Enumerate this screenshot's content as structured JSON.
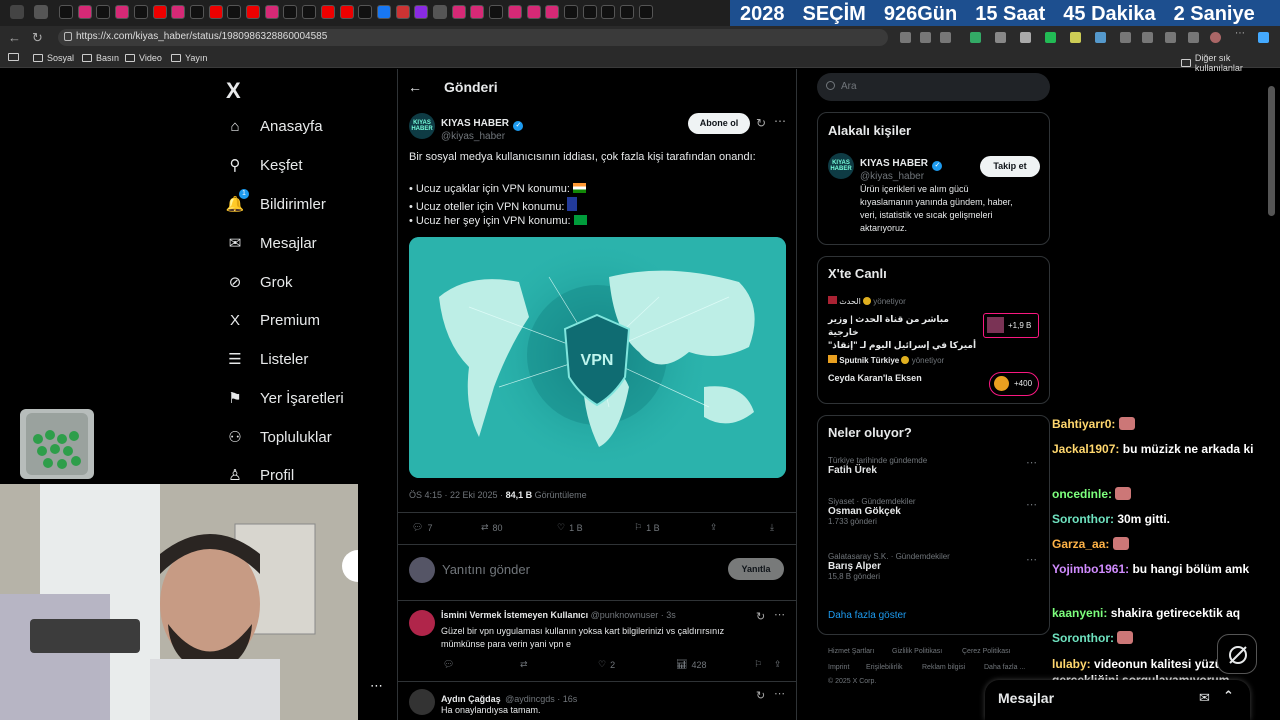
{
  "browser": {
    "url": "https://x.com/kiyas_haber/status/1980986328860004585",
    "countdown": [
      "2028",
      "SEÇİM",
      "926Gün",
      "15 Saat",
      "45 Dakika",
      "2 Saniye"
    ],
    "bookmarks": [
      "Sosyal",
      "Basın",
      "Video",
      "Yayın"
    ],
    "other_bookmarks": "Diğer sık kullanılanlar"
  },
  "nav": {
    "logo": "X",
    "items": [
      {
        "label": "Anasayfa",
        "icon": "home-icon",
        "glyph": "⌂"
      },
      {
        "label": "Keşfet",
        "icon": "search-icon",
        "glyph": "⚲"
      },
      {
        "label": "Bildirimler",
        "icon": "bell-icon",
        "glyph": "🔔",
        "badge": "1"
      },
      {
        "label": "Mesajlar",
        "icon": "mail-icon",
        "glyph": "✉"
      },
      {
        "label": "Grok",
        "icon": "grok-icon",
        "glyph": "⊘"
      },
      {
        "label": "Premium",
        "icon": "x-premium-icon",
        "glyph": "X"
      },
      {
        "label": "Listeler",
        "icon": "list-icon",
        "glyph": "☰"
      },
      {
        "label": "Yer İşaretleri",
        "icon": "bookmark-icon",
        "glyph": "⚑"
      },
      {
        "label": "Topluluklar",
        "icon": "communities-icon",
        "glyph": "⚇"
      },
      {
        "label": "Profil",
        "icon": "profile-icon",
        "glyph": "♙"
      }
    ]
  },
  "post": {
    "header": "Gönderi",
    "author_name": "KIYAS HABER",
    "author_handle": "@kiyas_haber",
    "avatar_text": "KIYAS HABER",
    "subscribe_label": "Abone ol",
    "text_line1": "Bir sosyal medya kullanıcısının iddiası, çok fazla kişi tarafından onandı:",
    "bullets": [
      "• Ucuz uçaklar için VPN konumu:",
      "• Ucuz oteller için VPN konumu:",
      "• Ucuz her şey için VPN konumu:"
    ],
    "media_label": "VPN",
    "time": "ÖS 4:15 · 22 Eki 2025 ·",
    "views_count": "84,1 B",
    "views_label": "Görüntüleme",
    "actions": {
      "replies": "7",
      "reposts": "80",
      "likes": "1 B",
      "bookmarks": "1 B"
    },
    "reply_placeholder": "Yanıtını gönder",
    "reply_button": "Yanıtla"
  },
  "replies": [
    {
      "name": "İsmini Vermek İstemeyen Kullanıcı",
      "handle": "@punknownuser · 3s",
      "text1": "Güzel bir vpn uygulaması kullanın yoksa kart bilgilerinizi vs çaldırırsınız",
      "text2": "mümkünse para verin yani vpn e",
      "likes": "2",
      "views": "428"
    },
    {
      "name": "Aydın Çağdaş",
      "handle": "@aydincgds · 16s",
      "text1": "Ha onaylandıysa tamam."
    }
  ],
  "sidebar": {
    "search_placeholder": "Ara",
    "related_title": "Alakalı kişiler",
    "related_name": "KIYAS HABER",
    "related_handle": "@kiyas_haber",
    "follow_label": "Takip et",
    "related_bio": [
      "Ürün içerikleri ve alım gücü",
      "kıyaslamanın yanında gündem, haber,",
      "veri, istatistik ve sıcak gelişmeleri",
      "aktarıyoruz."
    ],
    "live_title": "X'te Canlı",
    "live": [
      {
        "host": "الحدث",
        "role": "yönetiyor",
        "title1": "مباشر من قناة الحدث | وزير خارجية",
        "title2": "أميركا في إسرائيل اليوم لـ \"إنقاذ\" ...",
        "count": "+1,9 B"
      },
      {
        "host": "Sputnik Türkiye",
        "role": "yönetiyor",
        "title1": "Ceyda Karan'la Eksen",
        "count": "+400"
      }
    ],
    "trends_title": "Neler oluyor?",
    "trends": [
      {
        "context": "Türkiye tarihinde gündemde",
        "name": "Fatih Ürek",
        "count": ""
      },
      {
        "context": "Siyaset · Gündemdekiler",
        "name": "Osman Gökçek",
        "count": "1.733 gönderi"
      },
      {
        "context": "Galatasaray S.K. · Gündemdekiler",
        "name": "Barış Alper",
        "count": "15,8 B gönderi"
      }
    ],
    "show_more": "Daha fazla göster",
    "footer": [
      "Hizmet Şartları",
      "Gizlilik Politikası",
      "Çerez Politikası",
      "Imprint",
      "Erişilebilirlik",
      "Reklam bilgisi",
      "Daha fazla ...",
      "© 2025 X Corp."
    ]
  },
  "chat": [
    {
      "user": "Bahtiyarr0:",
      "color": "#ffd76e",
      "msg": ""
    },
    {
      "user": "Jackal1907:",
      "color": "#ffd76e",
      "msg": "bu müzizk ne arkada ki"
    },
    {
      "user": "oncedinle:",
      "color": "#7dff7d",
      "msg": ""
    },
    {
      "user": "Soronthor:",
      "color": "#6fe3c0",
      "msg": "30m gitti."
    },
    {
      "user": "Garza_aa:",
      "color": "#ffb347",
      "msg": ""
    },
    {
      "user": "Yojimbo1961:",
      "color": "#d18cff",
      "msg": "bu hangi bölüm amk"
    },
    {
      "user": "kaanyeni:",
      "color": "#7dff7d",
      "msg": "shakira getirecektik aq"
    },
    {
      "user": "Soronthor:",
      "color": "#6fe3c0",
      "msg": ""
    },
    {
      "user": "lulaby:",
      "color": "#ffd76e",
      "msg": "videonun kalitesi yüzünden gercekliğini sorgulayamıyorum"
    }
  ],
  "messages_drawer": "Mesajlar",
  "colors": {
    "accent": "#1d9bf0",
    "bg": "#000000",
    "border": "#2f3336",
    "muted": "#71767b",
    "live_border": "#f91880"
  }
}
